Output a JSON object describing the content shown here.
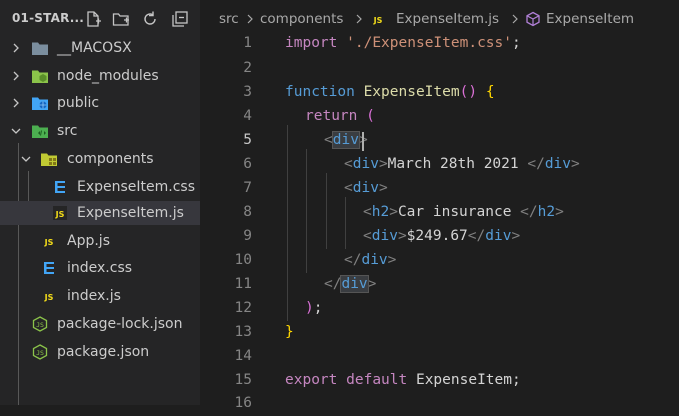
{
  "explorer": {
    "title": "01-STAR...",
    "items": [
      {
        "label": "__MACOSX",
        "icon": "folder-icon"
      },
      {
        "label": "node_modules",
        "icon": "node-folder-icon"
      },
      {
        "label": "public",
        "icon": "public-folder-icon"
      },
      {
        "label": "src",
        "icon": "src-folder-icon"
      },
      {
        "label": "components",
        "icon": "components-folder-icon"
      },
      {
        "label": "ExpenseItem.css",
        "icon": "css-file-icon"
      },
      {
        "label": "ExpenseItem.js",
        "icon": "js-file-icon"
      },
      {
        "label": "App.js",
        "icon": "js-file-icon"
      },
      {
        "label": "index.css",
        "icon": "css-file-icon"
      },
      {
        "label": "index.js",
        "icon": "js-file-icon"
      },
      {
        "label": "package-lock.json",
        "icon": "json-file-icon"
      },
      {
        "label": "package.json",
        "icon": "json-file-icon"
      }
    ],
    "js_badge": "JS",
    "css_badge": "3",
    "json_badge": "{}"
  },
  "breadcrumb": {
    "part1": "src",
    "part2": "components",
    "part3": "ExpenseItem.js",
    "part4": "ExpenseItem"
  },
  "editor": {
    "active_line": "5",
    "line_numbers": [
      "1",
      "2",
      "3",
      "4",
      "5",
      "6",
      "7",
      "8",
      "9",
      "10",
      "11",
      "12",
      "13",
      "14",
      "15",
      "16"
    ],
    "tokens": {
      "l1_import": "import",
      "l1_path": "'./ExpenseItem.css'",
      "l1_semi": ";",
      "l3_function": "function",
      "l3_name": "ExpenseItem",
      "l3_parens": "()",
      "l3_brace": "{",
      "l4_return": "return",
      "l4_paren": "(",
      "tag_div": "div",
      "tag_h2": "h2",
      "lt": "<",
      "gt": ">",
      "close_lt": "</",
      "l6_text": "March 28th 2021 ",
      "l8_text": "Car insurance ",
      "l9_text": "$249.67",
      "l12_paren": ")",
      "l12_semi": ";",
      "l13_brace": "}",
      "l15_export": "export",
      "l15_default": "default",
      "l15_name": "ExpenseItem",
      "l15_semi": ";"
    }
  }
}
